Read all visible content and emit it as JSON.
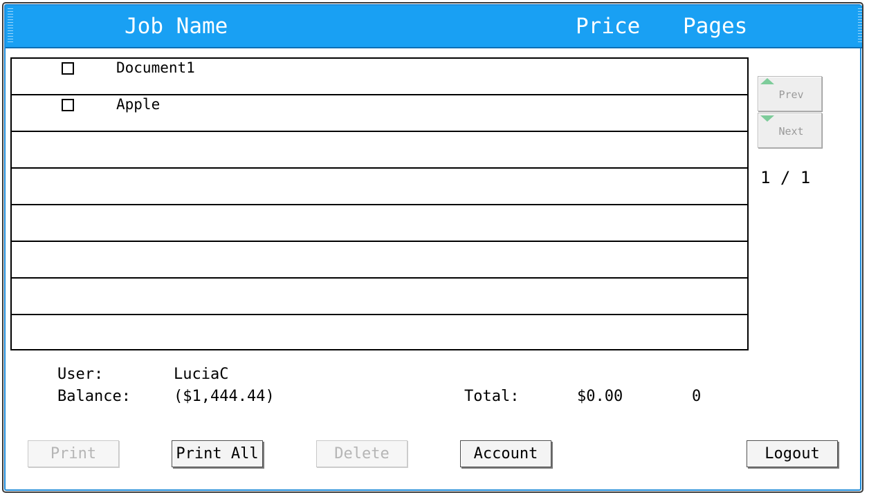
{
  "header": {
    "job_name": "Job Name",
    "price": "Price",
    "pages": "Pages"
  },
  "jobs": [
    {
      "name": "Document1"
    },
    {
      "name": "Apple"
    }
  ],
  "pager": {
    "prev_label": "Prev",
    "next_label": "Next",
    "page_indicator": "1 / 1"
  },
  "summary": {
    "user_label": "User:",
    "user_value": "LuciaC",
    "balance_label": "Balance:",
    "balance_value": "($1,444.44)",
    "total_label": "Total:",
    "total_price": "$0.00",
    "total_pages": "0"
  },
  "buttons": {
    "print": "Print",
    "print_all": "Print All",
    "delete": "Delete",
    "account": "Account",
    "logout": "Logout"
  },
  "colors": {
    "header_bg": "#19a0f3",
    "frame_border": "#1e8ad8",
    "arrow_accent": "#7dcc9a"
  }
}
